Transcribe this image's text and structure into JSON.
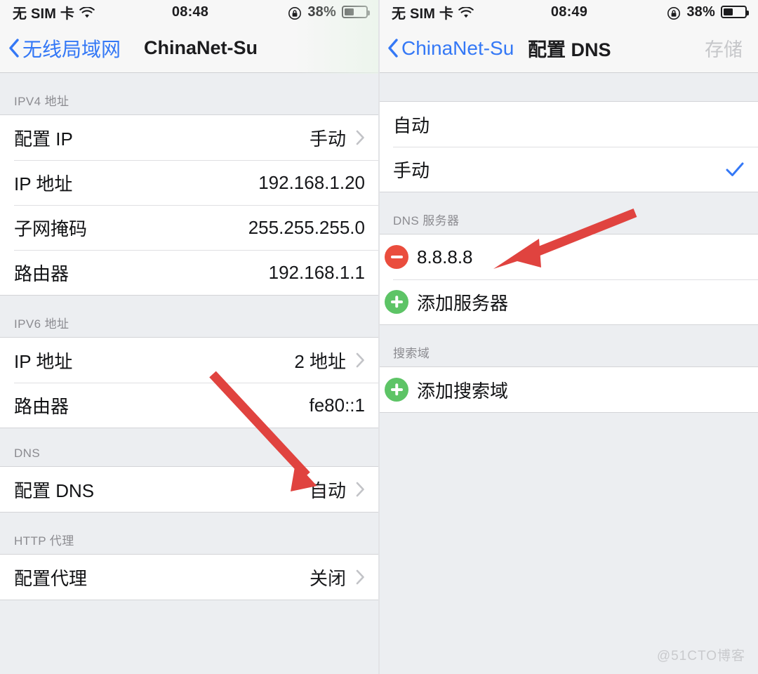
{
  "colors": {
    "accent_blue": "#3478f6",
    "arrow_red": "#e0433f",
    "minus_red": "#ea4d3d",
    "plus_green": "#5dc466",
    "background_gray": "#eceef1",
    "row_white": "#ffffff",
    "disabled_gray": "#c6c7ca"
  },
  "left_panel": {
    "status_bar": {
      "carrier": "无 SIM 卡",
      "wifi_icon": "wifi-icon",
      "time": "08:48",
      "rotation_lock_icon": "rotation-lock-icon",
      "battery_percent": "38%",
      "battery_icon": "battery-icon"
    },
    "nav": {
      "back_label": "无线局域网",
      "back_icon": "chevron-left-icon",
      "title": "ChinaNet-Su"
    },
    "sections": [
      {
        "header": "IPV4 地址",
        "rows": [
          {
            "label": "配置 IP",
            "value": "手动",
            "chevron": true
          },
          {
            "label": "IP 地址",
            "value": "192.168.1.20",
            "chevron": false
          },
          {
            "label": "子网掩码",
            "value": "255.255.255.0",
            "chevron": false
          },
          {
            "label": "路由器",
            "value": "192.168.1.1",
            "chevron": false
          }
        ]
      },
      {
        "header": "IPV6 地址",
        "rows": [
          {
            "label": "IP 地址",
            "value": "2 地址",
            "chevron": true
          },
          {
            "label": "路由器",
            "value": "fe80::1",
            "chevron": false
          }
        ]
      },
      {
        "header": "DNS",
        "rows": [
          {
            "label": "配置 DNS",
            "value": "自动",
            "chevron": true
          }
        ]
      },
      {
        "header": "HTTP 代理",
        "rows": [
          {
            "label": "配置代理",
            "value": "关闭",
            "chevron": true
          }
        ]
      }
    ]
  },
  "right_panel": {
    "status_bar": {
      "carrier": "无 SIM 卡",
      "wifi_icon": "wifi-icon",
      "time": "08:49",
      "rotation_lock_icon": "rotation-lock-icon",
      "battery_percent": "38%",
      "battery_icon": "battery-icon"
    },
    "nav": {
      "back_label": "ChinaNet-Su",
      "back_icon": "chevron-left-icon",
      "title": "配置 DNS",
      "action_label": "存储",
      "action_disabled": true
    },
    "mode_options": [
      {
        "label": "自动",
        "selected": false
      },
      {
        "label": "手动",
        "selected": true
      }
    ],
    "dns_servers": {
      "header": "DNS 服务器",
      "entries": [
        {
          "label": "8.8.8.8",
          "icon": "minus-circle-icon"
        }
      ],
      "add_label": "添加服务器",
      "add_icon": "plus-circle-icon"
    },
    "search_domains": {
      "header": "搜索域",
      "add_label": "添加搜索域",
      "add_icon": "plus-circle-icon"
    }
  },
  "annotations": {
    "arrow_left": "arrow pointing to 配置 DNS row value",
    "arrow_right": "arrow pointing to 8.8.8.8 DNS server entry"
  },
  "watermark": "@51CTO博客"
}
